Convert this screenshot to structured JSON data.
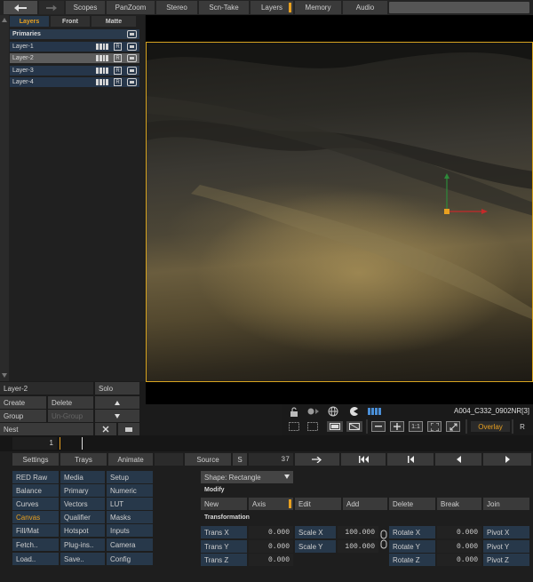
{
  "top_tabs": [
    "Scopes",
    "PanZoom",
    "Stereo",
    "Scn-Take",
    "Layers",
    "Memory",
    "Audio"
  ],
  "layer_tabs": [
    "Layers",
    "Front",
    "Matte"
  ],
  "primaries_label": "Primaries",
  "layers": [
    {
      "name": "Layer-1",
      "selected": false
    },
    {
      "name": "Layer-2",
      "selected": true
    },
    {
      "name": "Layer-3",
      "selected": false
    },
    {
      "name": "Layer-4",
      "selected": false
    }
  ],
  "r_badge": "R",
  "layer_controls": {
    "current_layer": "Layer-2",
    "solo": "Solo",
    "create": "Create",
    "delete": "Delete",
    "group": "Group",
    "ungroup": "Un-Group",
    "nest": "Nest"
  },
  "viewer": {
    "clip_name": "A004_C332_0902NR[3]",
    "overlay": "Overlay",
    "r_label": "R",
    "one_to_one": "1:1",
    "accent_color": "#d8a420"
  },
  "timeline": {
    "frame": "1"
  },
  "bottom_bar": {
    "settings": "Settings",
    "trays": "Trays",
    "animate": "Animate",
    "source": "Source",
    "s": "S",
    "frame_value": "37"
  },
  "menu_grid": [
    [
      "RED Raw",
      "Media",
      "Setup"
    ],
    [
      "Balance",
      "Primary",
      "Numeric"
    ],
    [
      "Curves",
      "Vectors",
      "LUT"
    ],
    [
      "Canvas",
      "Qualifier",
      "Masks"
    ],
    [
      "Fill/Mat",
      "Hotspot",
      "Inputs"
    ],
    [
      "Fetch..",
      "Plug-ins..",
      "Camera"
    ],
    [
      "Load..",
      "Save..",
      "Config"
    ]
  ],
  "active_menu": "Canvas",
  "shape": {
    "dropdown": "Shape: Rectangle",
    "modify_label": "Modify",
    "modify_buttons": [
      "New",
      "Axis",
      "Edit",
      "Add",
      "Delete",
      "Break",
      "Join"
    ],
    "transformation_label": "Transformation",
    "fields": [
      {
        "label": "Trans X",
        "value": "0.000"
      },
      {
        "label": "Trans Y",
        "value": "0.000"
      },
      {
        "label": "Trans Z",
        "value": "0.000"
      },
      {
        "label": "Scale X",
        "value": "100.000"
      },
      {
        "label": "Scale Y",
        "value": "100.000"
      },
      {
        "label": "Rotate X",
        "value": "0.000"
      },
      {
        "label": "Rotate Y",
        "value": "0.000"
      },
      {
        "label": "Rotate Z",
        "value": "0.000"
      },
      {
        "label": "Pivot X",
        "value": ""
      },
      {
        "label": "Pivot Y",
        "value": ""
      },
      {
        "label": "Pivot Z",
        "value": ""
      }
    ]
  }
}
